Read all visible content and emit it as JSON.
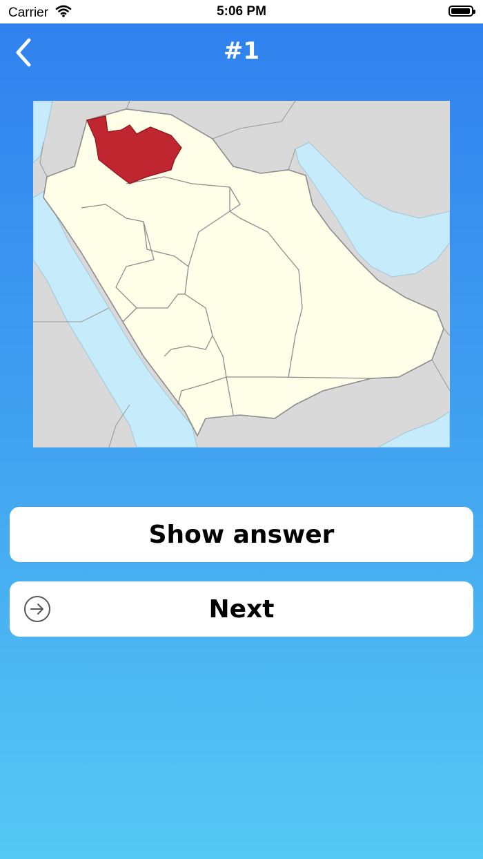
{
  "status_bar": {
    "carrier": "Carrier",
    "time": "5:06 PM",
    "battery_level_percent": 95
  },
  "nav": {
    "back_icon": "chevron-left-icon",
    "title": "#1"
  },
  "map": {
    "subject": "Saudi Arabia regions",
    "highlighted_region_color": "#c0262f",
    "land_color": "#fefee9",
    "water_color": "#c6ecfb",
    "neighbor_color": "#d9d9d9"
  },
  "buttons": {
    "show_answer_label": "Show answer",
    "next_label": "Next",
    "next_icon": "arrow-right-circle-icon"
  },
  "colors": {
    "gradient_top": "#2f7fee",
    "gradient_bottom": "#55c8f4",
    "button_bg": "#ffffff"
  }
}
